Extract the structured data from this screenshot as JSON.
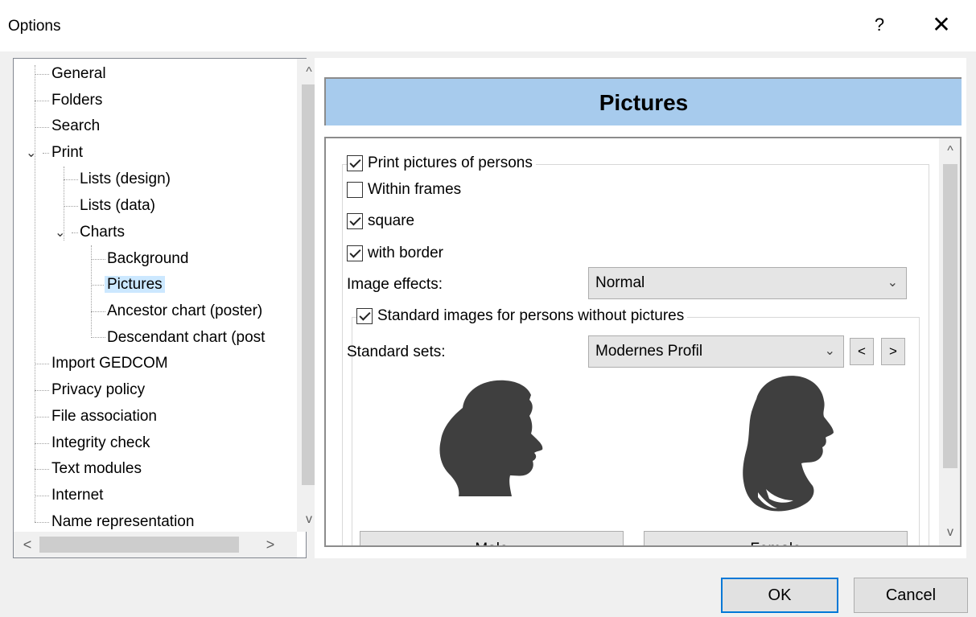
{
  "window": {
    "title": "Options",
    "help_label": "?",
    "close_label": "✕"
  },
  "tree": {
    "items": [
      {
        "label": "General"
      },
      {
        "label": "Folders"
      },
      {
        "label": "Search"
      },
      {
        "label": "Print"
      },
      {
        "label": "Lists (design)"
      },
      {
        "label": "Lists (data)"
      },
      {
        "label": "Charts"
      },
      {
        "label": "Background"
      },
      {
        "label": "Pictures"
      },
      {
        "label": "Ancestor chart (poster)"
      },
      {
        "label": "Descendant chart (post"
      },
      {
        "label": "Import GEDCOM"
      },
      {
        "label": "Privacy policy"
      },
      {
        "label": "File association"
      },
      {
        "label": "Integrity check"
      },
      {
        "label": "Text modules"
      },
      {
        "label": "Internet"
      },
      {
        "label": "Name representation"
      }
    ],
    "selected": "Pictures",
    "expand_icon": "chevron-down-icon",
    "scroll_up": "^",
    "scroll_down": "v",
    "scroll_left": "<",
    "scroll_right": ">"
  },
  "panel": {
    "header": "Pictures",
    "header_color": "#a7cbed",
    "print_pictures": {
      "label": "Print pictures of persons",
      "checked": true
    },
    "within_frames": {
      "label": "Within frames",
      "checked": false
    },
    "square": {
      "label": "square",
      "checked": true
    },
    "with_border": {
      "label": "with border",
      "checked": true
    },
    "image_effects": {
      "label": "Image effects:",
      "value": "Normal"
    },
    "standard_images": {
      "label": "Standard images for persons without pictures",
      "checked": true
    },
    "standard_sets": {
      "label": "Standard sets:",
      "value": "Modernes Profil",
      "prev": "<",
      "next": ">"
    },
    "male_button": "Male",
    "female_button": "Female",
    "scroll_up": "^",
    "scroll_down": "v"
  },
  "footer": {
    "ok_label": "OK",
    "cancel_label": "Cancel"
  }
}
